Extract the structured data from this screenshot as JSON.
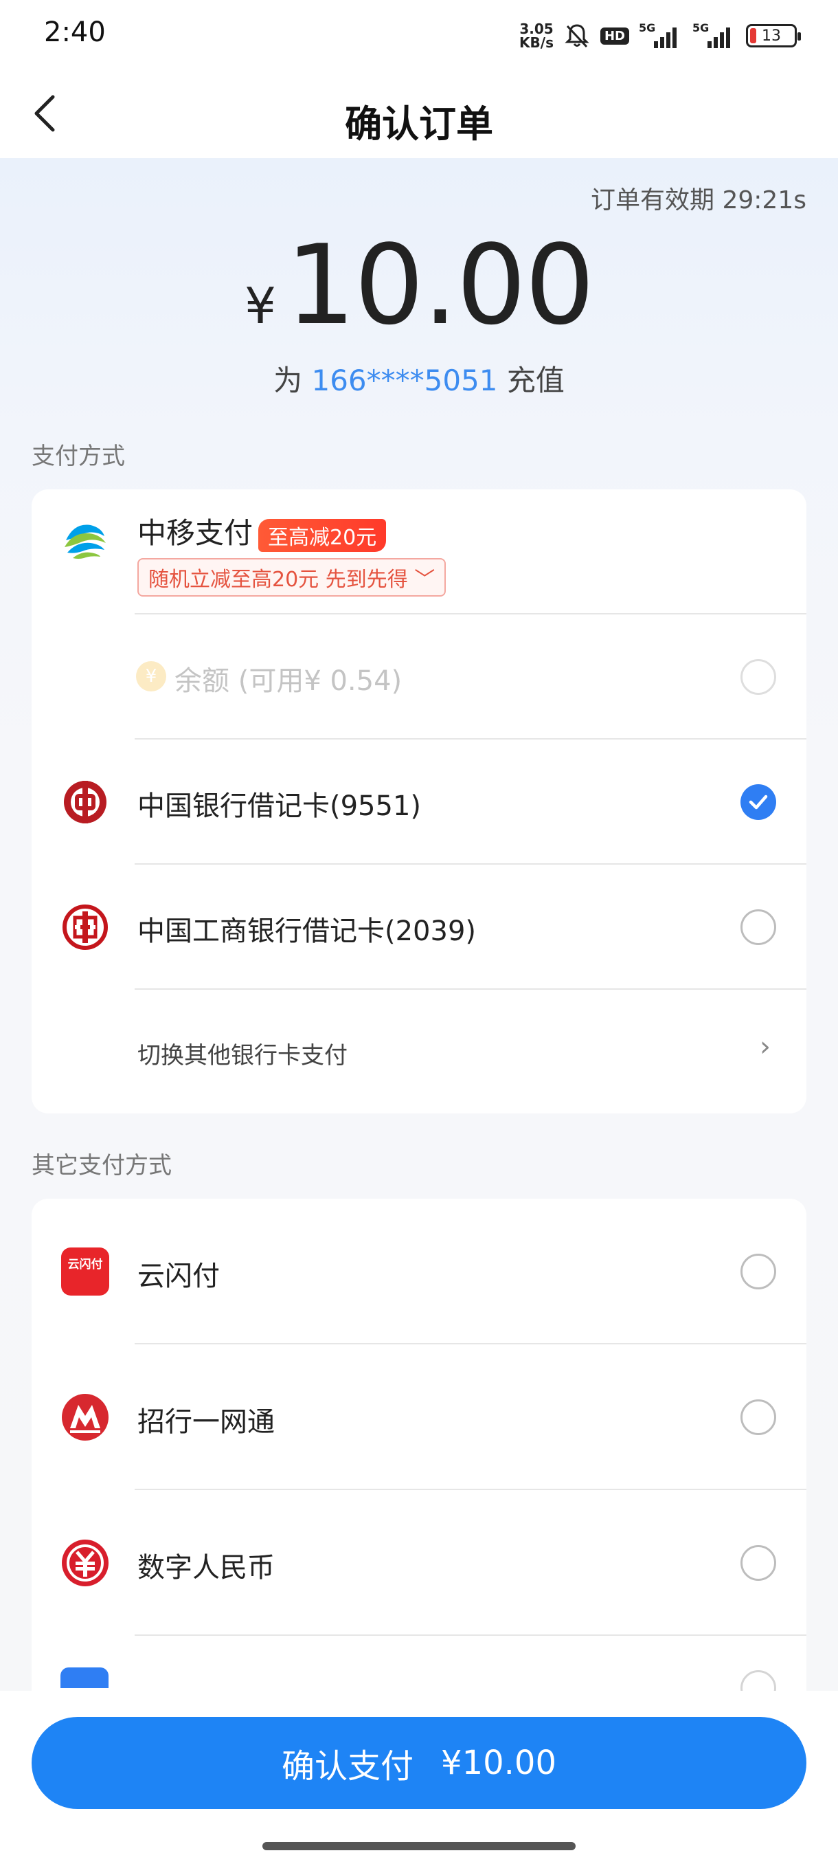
{
  "status_bar": {
    "time": "2:40",
    "net_speed_value": "3.05",
    "net_speed_unit": "KB/s",
    "hd_label": "HD",
    "sim1_label": "5G",
    "sim2_label": "5G",
    "battery_level": "13"
  },
  "header": {
    "title": "确认订单"
  },
  "order": {
    "validity_label": "订单有效期",
    "validity_time": "29:21s",
    "currency": "¥",
    "amount": "10.00",
    "recharge_prefix": "为",
    "phone": "166****5051",
    "recharge_suffix": "充值"
  },
  "payment_methods": {
    "section_label": "支付方式",
    "cmpay": {
      "name": "中移支付",
      "badge": "至高减20元",
      "promo": "随机立减至高20元 先到先得 ﹀"
    },
    "balance": {
      "icon_char": "¥",
      "label": "余额",
      "available": "(可用¥ 0.54)",
      "selected": false,
      "disabled": true
    },
    "cards": [
      {
        "name": "中国银行借记卡(9551)",
        "selected": true
      },
      {
        "name": "中国工商银行借记卡(2039)",
        "selected": false
      }
    ],
    "switch_card": "切换其他银行卡支付"
  },
  "other_methods": {
    "section_label": "其它支付方式",
    "items": [
      {
        "name": "云闪付",
        "icon_text": "云闪付",
        "selected": false
      },
      {
        "name": "招行一网通",
        "selected": false
      },
      {
        "name": "数字人民币",
        "selected": false
      }
    ]
  },
  "pay_button": {
    "label": "确认支付",
    "amount": "¥10.00"
  },
  "colors": {
    "accent": "#1e84f5",
    "phone_link": "#3d8cf0",
    "promo_red": "#ff3a2a",
    "boc_red": "#b81c22",
    "icbc_red": "#c4161c",
    "cmb_red": "#d7282f"
  }
}
